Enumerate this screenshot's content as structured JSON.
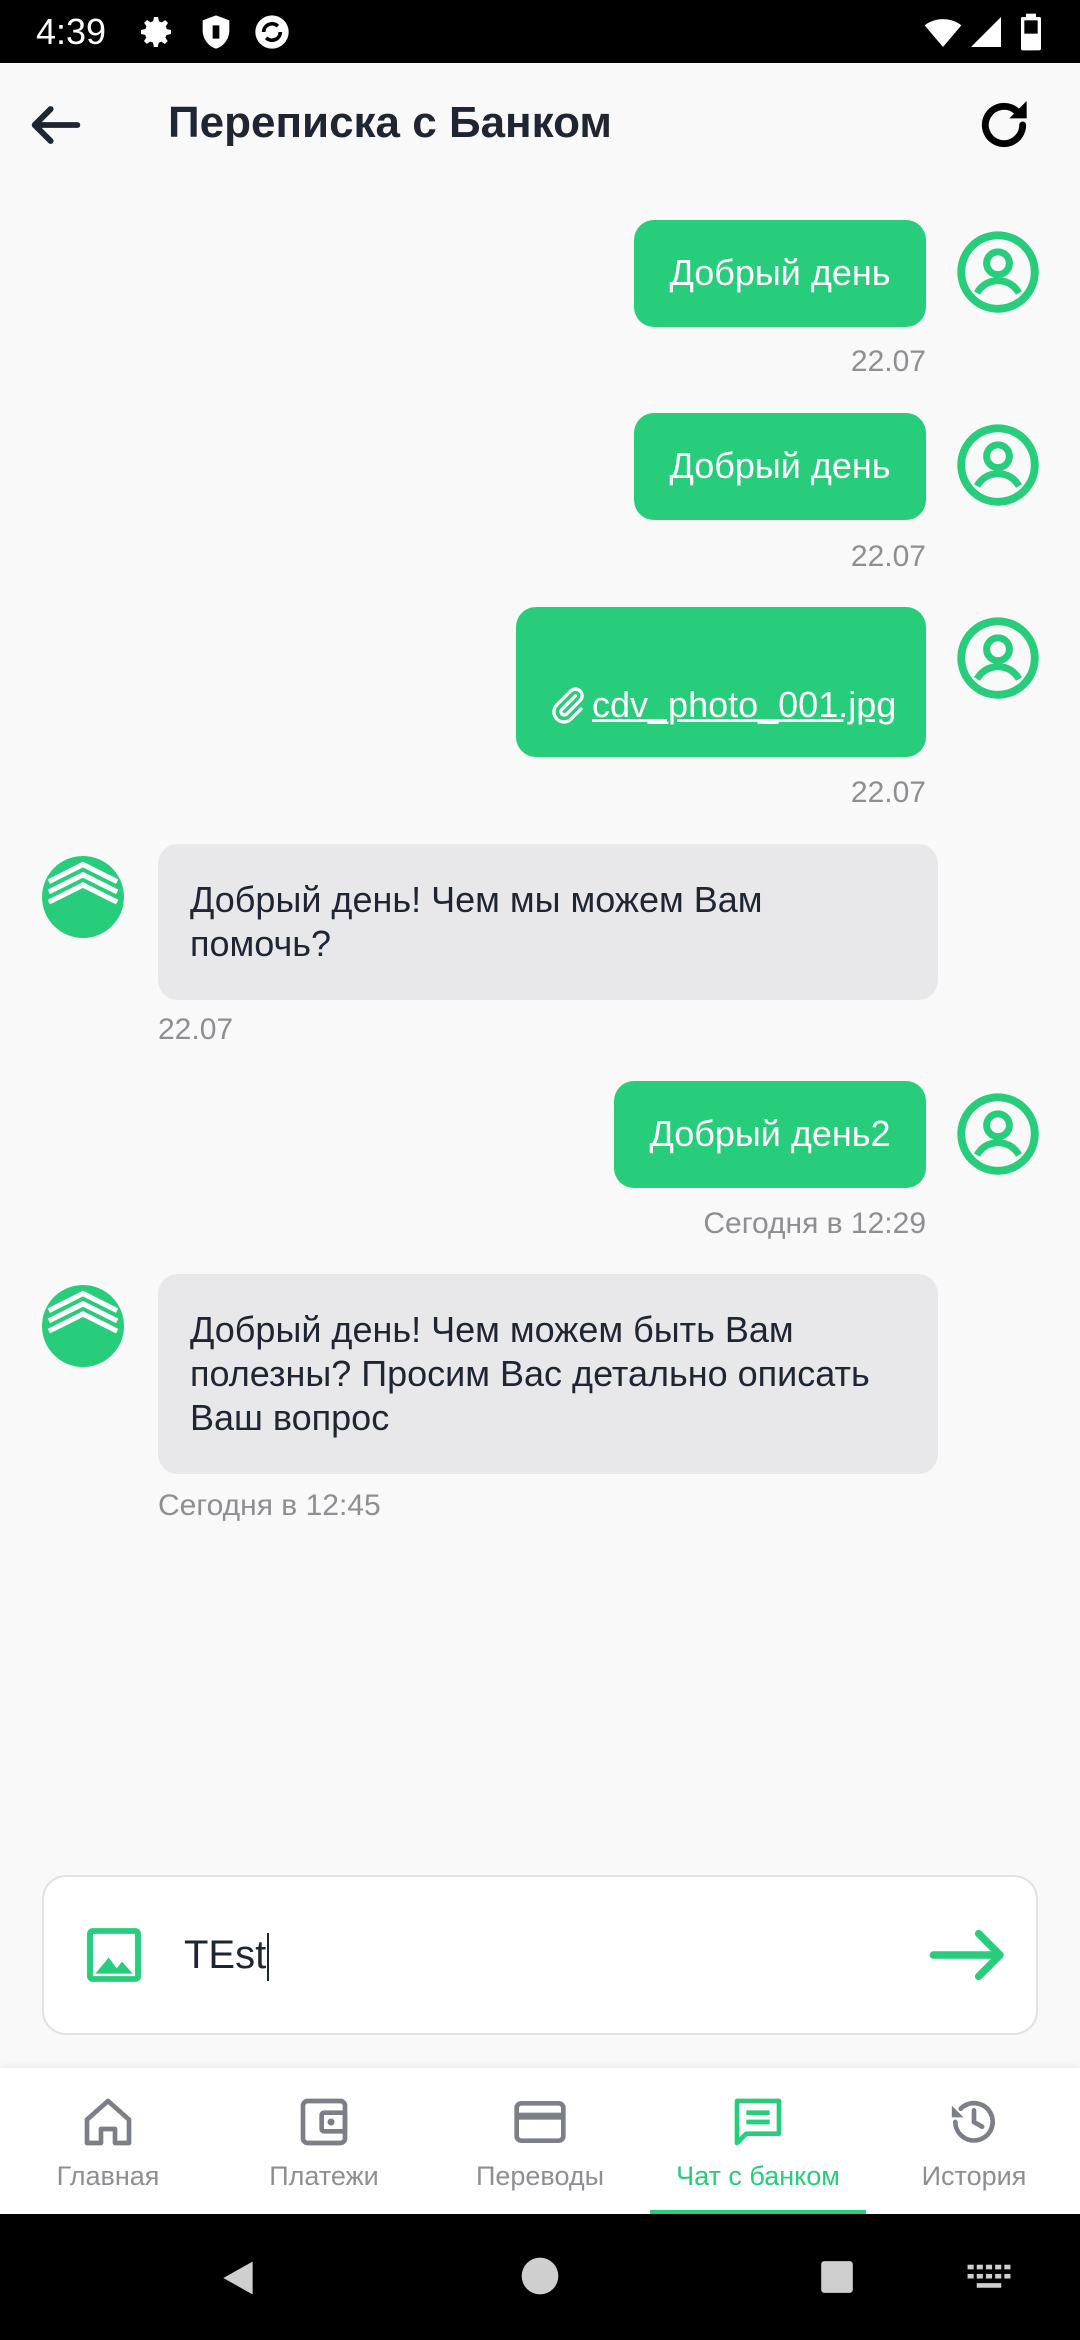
{
  "status_bar": {
    "time": "4:39"
  },
  "header": {
    "title": "Переписка с Банком"
  },
  "messages": [
    {
      "text": "Добрый день",
      "time": "22.07"
    },
    {
      "text": "Добрый день",
      "time": "22.07"
    },
    {
      "attachment": "cdv_photo_001.jpg",
      "time": "22.07"
    },
    {
      "text": "Добрый день! Чем мы можем Вам помочь?",
      "time": "22.07"
    },
    {
      "text": "Добрый день2",
      "time": "Сегодня в 12:29"
    },
    {
      "text": "Добрый день!  Чем можем быть Вам полезны?  Просим Вас детально описать Ваш вопрос",
      "time": "Сегодня в 12:45"
    }
  ],
  "composer": {
    "value": "TEst"
  },
  "bottom_nav": [
    {
      "label": "Главная"
    },
    {
      "label": "Платежи"
    },
    {
      "label": "Переводы"
    },
    {
      "label": "Чат с банком"
    },
    {
      "label": "История"
    }
  ],
  "colors": {
    "accent": "#27cd7a",
    "incoming_bubble": "#e8e8ea",
    "text_dark": "#1e2533",
    "muted": "#8e8e93"
  },
  "icons": [
    "back-arrow-icon",
    "refresh-icon",
    "user-avatar-icon",
    "bank-logo-icon",
    "paperclip-icon",
    "image-icon",
    "send-arrow-icon",
    "home-icon",
    "wallet-icon",
    "card-icon",
    "chat-icon",
    "history-icon"
  ]
}
